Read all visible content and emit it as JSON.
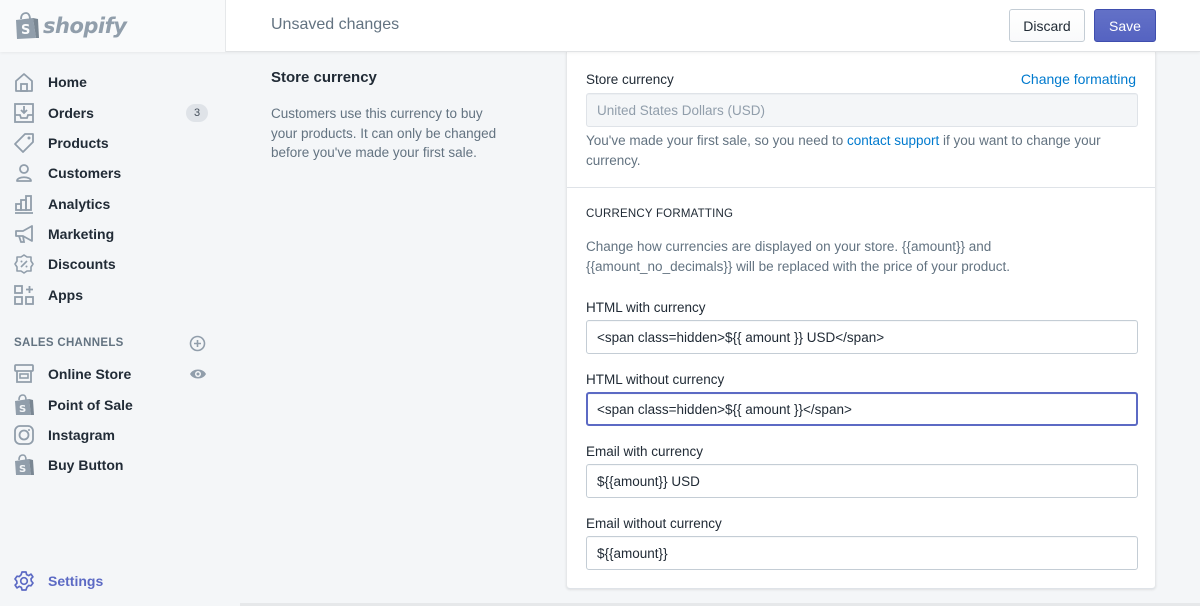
{
  "brand": {
    "name": "shopify"
  },
  "topbar": {
    "title": "Unsaved changes",
    "discard_label": "Discard",
    "save_label": "Save",
    "accent_color": "#5c6ac4"
  },
  "sidebar": {
    "items": [
      {
        "label": "Home",
        "icon": "home-icon"
      },
      {
        "label": "Orders",
        "icon": "orders-icon",
        "badge": "3"
      },
      {
        "label": "Products",
        "icon": "tag-icon"
      },
      {
        "label": "Customers",
        "icon": "person-icon"
      },
      {
        "label": "Analytics",
        "icon": "bar-chart-icon"
      },
      {
        "label": "Marketing",
        "icon": "megaphone-icon"
      },
      {
        "label": "Discounts",
        "icon": "discount-icon"
      },
      {
        "label": "Apps",
        "icon": "apps-icon"
      }
    ],
    "sales_channels": {
      "heading": "SALES CHANNELS",
      "items": [
        {
          "label": "Online Store",
          "icon": "storefront-icon"
        },
        {
          "label": "Point of Sale",
          "icon": "shopify-bag-icon"
        },
        {
          "label": "Instagram",
          "icon": "instagram-icon"
        },
        {
          "label": "Buy Button",
          "icon": "shopify-bag-icon"
        }
      ]
    },
    "settings": {
      "label": "Settings",
      "icon": "gear-icon"
    }
  },
  "section": {
    "title": "Store currency",
    "description": "Customers use this currency to buy your products. It can only be changed before you've made your first sale."
  },
  "card": {
    "store_currency_label": "Store currency",
    "change_formatting_link": "Change formatting",
    "store_currency_value": "United States Dollars (USD)",
    "help_prefix": "You've made your first sale, so you need to ",
    "help_link": "contact support",
    "help_suffix": " if you want to change your currency.",
    "formatting_heading": "CURRENCY FORMATTING",
    "formatting_description": "Change how currencies are displayed on your store. {{amount}} and {{amount_no_decimals}} will be replaced with the price of your product.",
    "fields": [
      {
        "label": "HTML with currency",
        "value": "<span class=hidden>${{ amount }} USD</span>"
      },
      {
        "label": "HTML without currency",
        "value": "<span class=hidden>${{ amount }}</span>"
      },
      {
        "label": "Email with currency",
        "value": "${{amount}} USD"
      },
      {
        "label": "Email without currency",
        "value": "${{amount}}"
      }
    ]
  }
}
